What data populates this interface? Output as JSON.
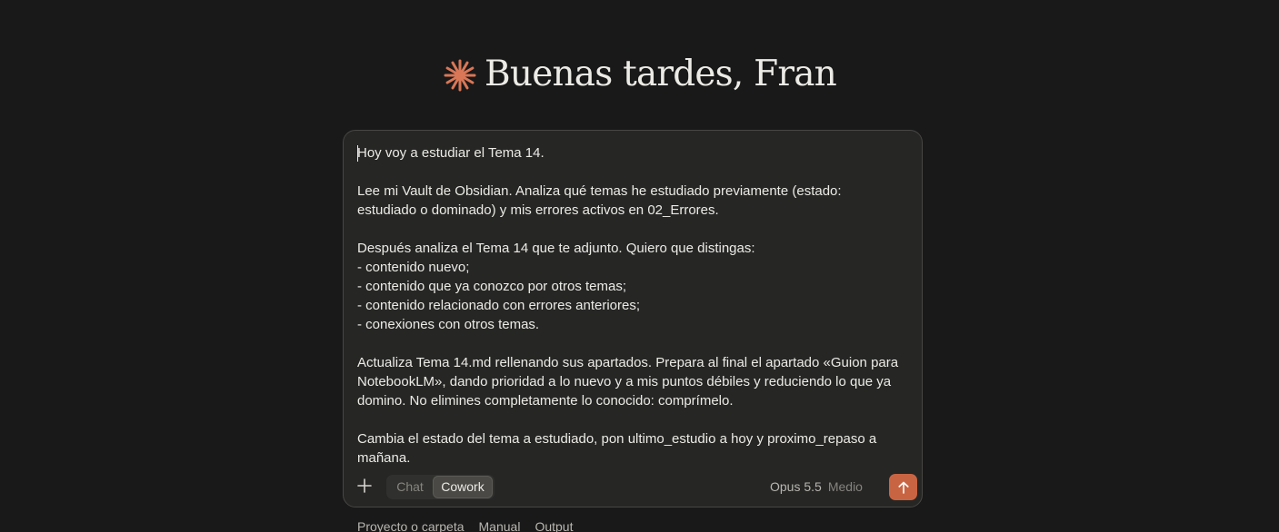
{
  "header": {
    "icon": "claude-starburst-icon",
    "greeting": "Buenas tardes, Fran"
  },
  "composer": {
    "prompt_paragraphs": [
      "Hoy voy a estudiar el Tema 14.",
      "",
      "Lee mi Vault de Obsidian. Analiza qué temas he estudiado previamente (estado:",
      "estudiado o dominado) y mis errores activos en 02_Errores.",
      "",
      "Después analiza el Tema 14 que te adjunto. Quiero que distingas:",
      "- contenido nuevo;",
      "- contenido que ya conozco por otros temas;",
      "- contenido relacionado con errores anteriores;",
      "- conexiones con otros temas.",
      "",
      "Actualiza Tema 14.md rellenando sus apartados. Prepara al final el apartado «Guion para",
      "NotebookLM», dando prioridad a lo nuevo y a mis puntos débiles y reduciendo lo que ya",
      "domino. No elimines completamente lo conocido: comprímelo.",
      "",
      "Cambia el estado del tema a estudiado, pon ultimo_estudio a hoy y proximo_repaso a",
      "mañana."
    ],
    "add_icon": "plus-icon",
    "mode_options": [
      "Chat",
      "Cowork"
    ],
    "selected_mode": "Cowork",
    "model": "Opus 5.5",
    "effort": "Medio",
    "send_icon": "arrow-up-icon"
  },
  "colors": {
    "background": "#1a1919",
    "composer_background": "#262625",
    "accent": "#c96442",
    "text": "#ecebe6"
  },
  "footer": {
    "links": [
      "Proyecto o carpeta",
      "Manual",
      "Output"
    ]
  }
}
